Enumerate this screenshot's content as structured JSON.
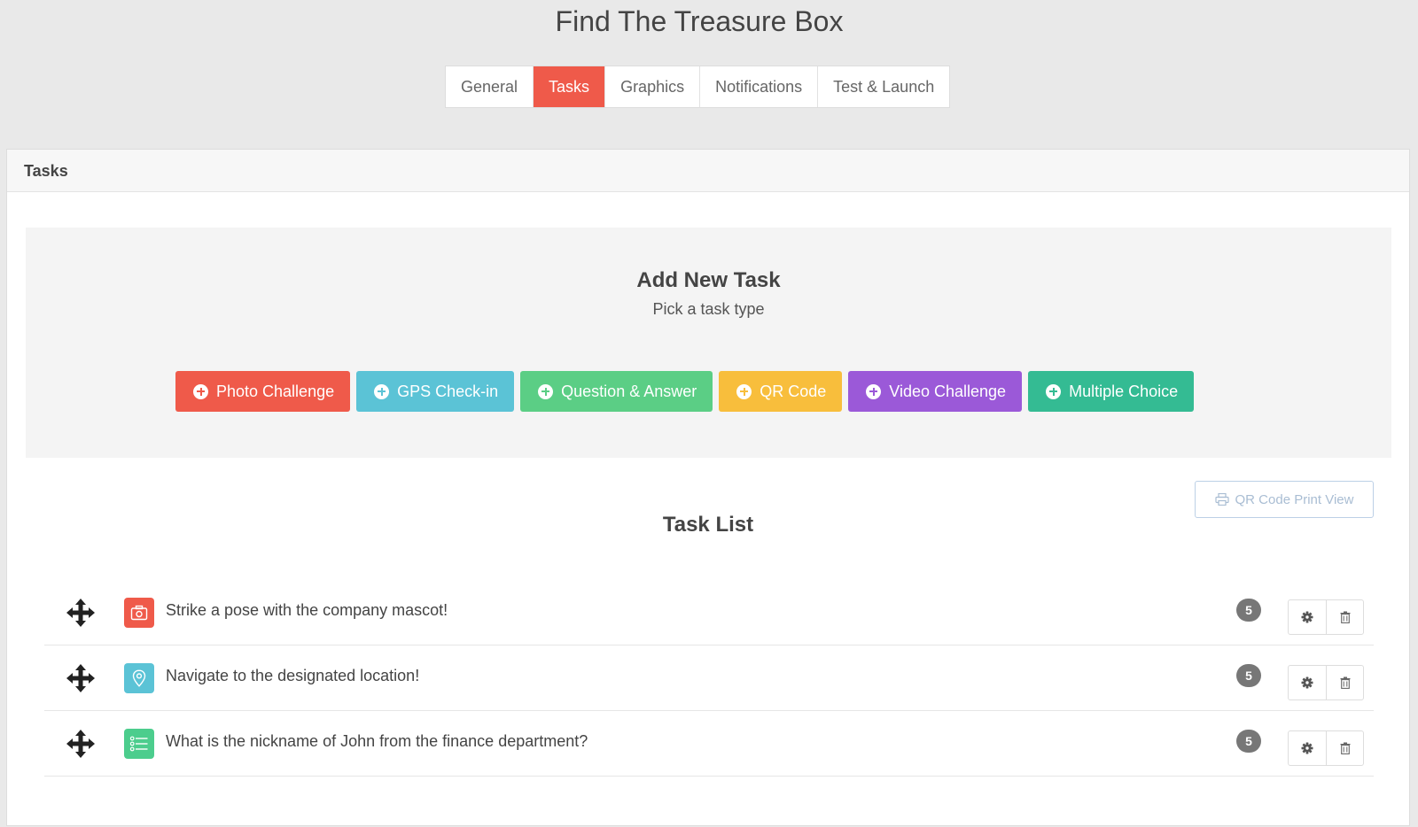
{
  "app": {
    "title": "Find The Treasure Box"
  },
  "tabs": [
    {
      "label": "General",
      "active": false
    },
    {
      "label": "Tasks",
      "active": true
    },
    {
      "label": "Graphics",
      "active": false
    },
    {
      "label": "Notifications",
      "active": false
    },
    {
      "label": "Test & Launch",
      "active": false
    }
  ],
  "panel": {
    "header": "Tasks"
  },
  "add_task": {
    "title": "Add New Task",
    "subtitle": "Pick a task type",
    "types": [
      {
        "label": "Photo Challenge",
        "color": "#ef5a4a"
      },
      {
        "label": "GPS Check-in",
        "color": "#5bc3d6"
      },
      {
        "label": "Question & Answer",
        "color": "#5bce85"
      },
      {
        "label": "QR Code",
        "color": "#f8be3c"
      },
      {
        "label": "Video Challenge",
        "color": "#9b59d8"
      },
      {
        "label": "Multiple Choice",
        "color": "#34bb93"
      }
    ]
  },
  "qr_print": {
    "label": "QR Code Print View"
  },
  "task_list": {
    "title": "Task List",
    "tasks": [
      {
        "text": "Strike a pose with the company mascot!",
        "points": "5",
        "icon": "camera-icon",
        "color": "#ef5a4a"
      },
      {
        "text": "Navigate to the designated location!",
        "points": "5",
        "icon": "map-pin-icon",
        "color": "#5bc3d6"
      },
      {
        "text": "What is the nickname of John from the finance department?",
        "points": "5",
        "icon": "list-icon",
        "color": "#4ccd8d"
      }
    ]
  }
}
